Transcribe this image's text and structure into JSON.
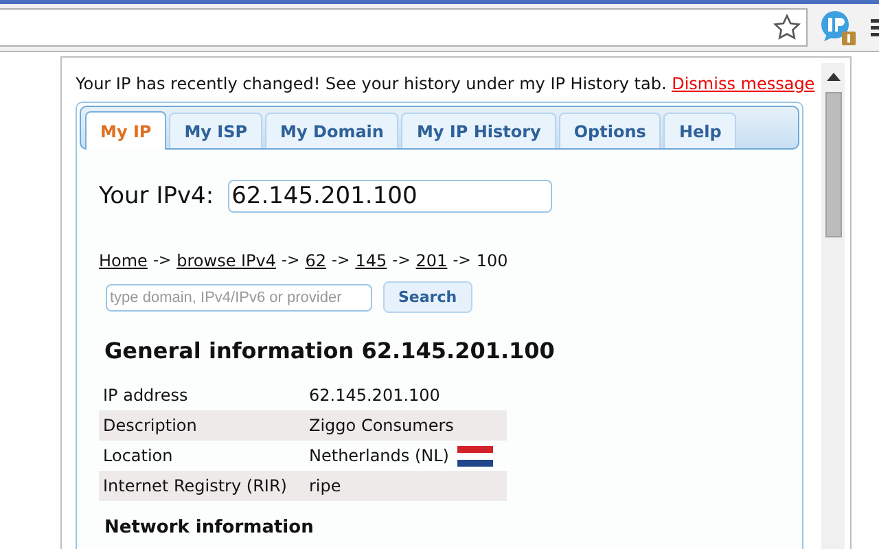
{
  "notice": {
    "text": "Your IP has recently changed! See your history under my IP History tab.",
    "link": "Dismiss message"
  },
  "tabs": [
    {
      "label": "My IP",
      "selected": true
    },
    {
      "label": "My ISP",
      "selected": false
    },
    {
      "label": "My Domain",
      "selected": false
    },
    {
      "label": "My IP History",
      "selected": false
    },
    {
      "label": "Options",
      "selected": false
    },
    {
      "label": "Help",
      "selected": false
    }
  ],
  "ip_field": {
    "label": "Your IPv4:",
    "value": "62.145.201.100"
  },
  "breadcrumb": {
    "separator": "->",
    "items": [
      {
        "text": "Home",
        "linked": true
      },
      {
        "text": "browse IPv4",
        "linked": true
      },
      {
        "text": "62",
        "linked": true
      },
      {
        "text": "145",
        "linked": true
      },
      {
        "text": "201",
        "linked": true
      },
      {
        "text": "100",
        "linked": false
      }
    ]
  },
  "search": {
    "placeholder": "type domain, IPv4/IPv6 or provider",
    "button": "Search"
  },
  "general": {
    "title": "General information 62.145.201.100",
    "rows": [
      {
        "label": "IP address",
        "value": "62.145.201.100",
        "kind": "text"
      },
      {
        "label": "Description",
        "value": "Ziggo Consumers",
        "kind": "text"
      },
      {
        "label": "Location",
        "value": "Netherlands (NL)",
        "kind": "flag"
      },
      {
        "label": "Internet Registry (RIR)",
        "value": "ripe",
        "kind": "text"
      }
    ]
  },
  "network": {
    "title": "Network information"
  }
}
